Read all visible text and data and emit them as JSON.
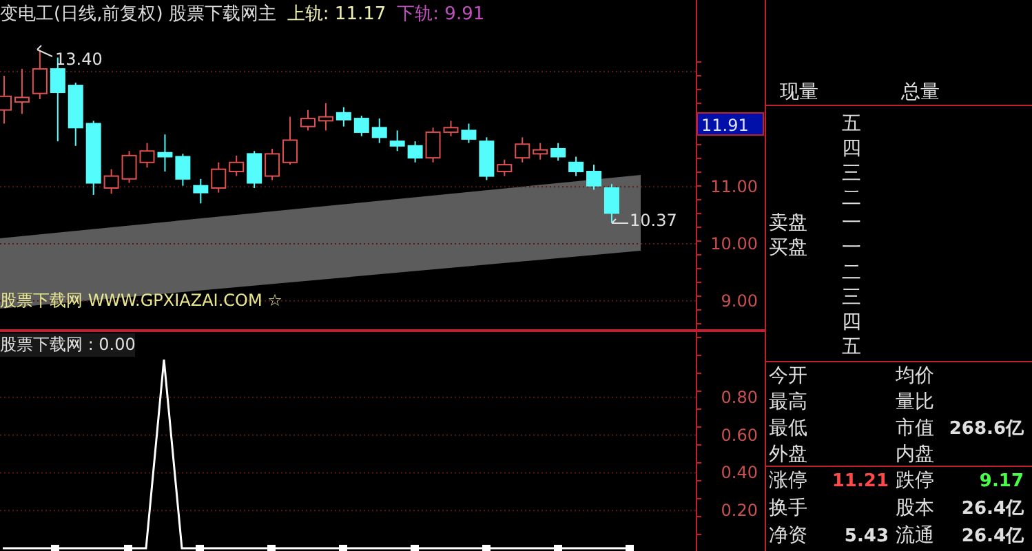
{
  "chart_header": {
    "title": "变电工(日线,前复权)",
    "indicator": "股票下载网主",
    "bands": [
      {
        "text": "上轨: 11.17",
        "color": "#f0f0b0"
      },
      {
        "text": "下轨: 9.91",
        "color": "#c050c0"
      }
    ]
  },
  "price_chart": {
    "high_label": "13.40",
    "low_label": "10.37",
    "source_note": "股票下载网 WWW.GPXIAZAI.COM ☆",
    "current_price": "11.91",
    "chart_data": {
      "type": "candlestick",
      "grid": true,
      "ylim": [
        8.49,
        14.28
      ],
      "yticks": [
        {
          "value": 11,
          "label": "11.00"
        },
        {
          "value": 10,
          "label": "10.00"
        },
        {
          "value": 9,
          "label": "9.00"
        }
      ],
      "ohlc": [
        [
          12.35,
          12.95,
          12.11,
          12.59
        ],
        [
          12.49,
          13.07,
          12.28,
          12.57
        ],
        [
          12.64,
          13.4,
          12.54,
          13.07
        ],
        [
          13.07,
          13.27,
          11.8,
          12.66
        ],
        [
          12.78,
          12.83,
          11.72,
          12.04
        ],
        [
          12.11,
          12.16,
          10.86,
          11.07
        ],
        [
          10.98,
          11.31,
          10.88,
          11.19
        ],
        [
          11.14,
          11.63,
          11.07,
          11.55
        ],
        [
          11.43,
          11.77,
          11.34,
          11.63
        ],
        [
          11.6,
          11.92,
          11.27,
          11.53
        ],
        [
          11.53,
          11.58,
          11.02,
          11.14
        ],
        [
          11.02,
          11.14,
          10.71,
          10.9
        ],
        [
          10.98,
          11.43,
          10.9,
          11.31
        ],
        [
          11.27,
          11.55,
          11.19,
          11.43
        ],
        [
          11.58,
          11.63,
          10.98,
          11.07
        ],
        [
          11.19,
          11.67,
          11.12,
          11.58
        ],
        [
          11.43,
          12.23,
          11.39,
          11.82
        ],
        [
          12.06,
          12.35,
          11.99,
          12.2
        ],
        [
          12.16,
          12.47,
          11.99,
          12.23
        ],
        [
          12.3,
          12.4,
          12.06,
          12.18
        ],
        [
          12.2,
          12.25,
          11.89,
          11.96
        ],
        [
          12.04,
          12.2,
          11.77,
          11.87
        ],
        [
          11.8,
          11.99,
          11.63,
          11.72
        ],
        [
          11.72,
          11.8,
          11.43,
          11.51
        ],
        [
          11.51,
          12.04,
          11.43,
          11.96
        ],
        [
          11.96,
          12.16,
          11.89,
          12.04
        ],
        [
          11.99,
          12.11,
          11.77,
          11.84
        ],
        [
          11.8,
          11.87,
          11.12,
          11.19
        ],
        [
          11.27,
          11.48,
          11.19,
          11.39
        ],
        [
          11.51,
          11.87,
          11.43,
          11.75
        ],
        [
          11.58,
          11.77,
          11.48,
          11.65
        ],
        [
          11.67,
          11.77,
          11.46,
          11.53
        ],
        [
          11.43,
          11.53,
          11.19,
          11.27
        ],
        [
          11.27,
          11.39,
          10.95,
          11.02
        ],
        [
          10.98,
          11.05,
          10.37,
          10.54
        ]
      ]
    }
  },
  "indicator_panel": {
    "chart_data": {
      "type": "line",
      "grid": true,
      "ylim": [
        0,
        1.15
      ],
      "yticks": [
        {
          "value": 0.2,
          "label": "0.20"
        },
        {
          "value": 0.4,
          "label": "0.40"
        },
        {
          "value": 0.6,
          "label": "0.60"
        },
        {
          "value": 0.8,
          "label": "0.80"
        }
      ],
      "series": [
        {
          "name": "股票下载网 : 0.00",
          "color": "#ffffff",
          "values": [
            0,
            0,
            0,
            0,
            0,
            0,
            0,
            0,
            0,
            1,
            0,
            0,
            0,
            0,
            0,
            0,
            0,
            0,
            0,
            0,
            0,
            0,
            0,
            0,
            0,
            0,
            0,
            0,
            0,
            0,
            0,
            0,
            0,
            0,
            0,
            0
          ]
        }
      ]
    }
  },
  "order_book": {
    "headers": [
      "现量",
      "总量"
    ],
    "sell_label": "卖盘",
    "buy_label": "买盘",
    "sell_levels": [
      "五",
      "四",
      "三",
      "二",
      "一"
    ],
    "buy_levels": [
      "一",
      "二",
      "三",
      "四",
      "五"
    ]
  },
  "quote_stats": [
    {
      "label": "今开"
    },
    {
      "label": "均价"
    },
    {
      "label": "最高"
    },
    {
      "label": "量比"
    },
    {
      "label": "最低"
    },
    {
      "label": "市值",
      "value": "268.6亿",
      "color": "#e0e0e0"
    },
    {
      "label": "外盘"
    },
    {
      "label": "内盘"
    }
  ],
  "limit_stats": [
    {
      "label": "涨停",
      "value": "11.21",
      "color": "#ff4848"
    },
    {
      "label": "跌停",
      "value": "9.17",
      "color": "#48ff48"
    },
    {
      "label": "换手"
    },
    {
      "label": "股本",
      "value": "26.4亿",
      "color": "#e0e0e0"
    },
    {
      "label": "净资",
      "value": "5.43",
      "color": "#e0e0e0"
    },
    {
      "label": "流通",
      "value": "26.4亿",
      "color": "#e0e0e0"
    }
  ]
}
